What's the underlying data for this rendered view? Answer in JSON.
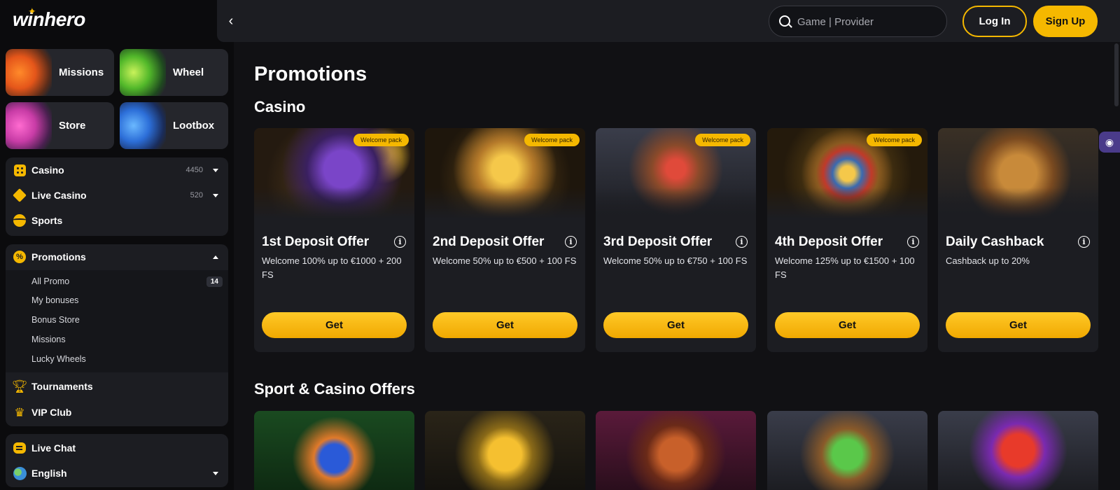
{
  "brand": {
    "logo_text": "winhero"
  },
  "sidebar": {
    "tiles": [
      {
        "label": "Missions"
      },
      {
        "label": "Wheel"
      },
      {
        "label": "Store"
      },
      {
        "label": "Lootbox"
      }
    ],
    "main_nav": [
      {
        "label": "Casino",
        "count": "4450",
        "icon": "dice-icon"
      },
      {
        "label": "Live Casino",
        "count": "520",
        "icon": "diamond-icon"
      },
      {
        "label": "Sports",
        "icon": "ball-icon"
      }
    ],
    "promotions": {
      "label": "Promotions",
      "icon": "promo-icon",
      "expanded": true,
      "items": [
        {
          "label": "All Promo",
          "badge": "14"
        },
        {
          "label": "My bonuses"
        },
        {
          "label": "Bonus Store"
        },
        {
          "label": "Missions"
        },
        {
          "label": "Lucky Wheels"
        }
      ]
    },
    "extra_nav": [
      {
        "label": "Tournaments",
        "icon": "trophy-icon"
      },
      {
        "label": "VIP Club",
        "icon": "crown-icon"
      }
    ],
    "footer_nav": [
      {
        "label": "Live Chat",
        "icon": "chat-icon"
      },
      {
        "label": "English",
        "icon": "globe-icon"
      }
    ]
  },
  "header": {
    "search_placeholder": "Game | Provider",
    "login_label": "Log In",
    "signup_label": "Sign Up"
  },
  "main": {
    "title": "Promotions",
    "sections": [
      {
        "title": "Casino",
        "cards": [
          {
            "tag": "Welcome pack",
            "title": "1st Deposit Offer",
            "description": "Welcome 100% up to €1000 + 200 FS",
            "button": "Get"
          },
          {
            "tag": "Welcome pack",
            "title": "2nd Deposit Offer",
            "description": "Welcome 50% up to €500 + 100 FS",
            "button": "Get"
          },
          {
            "tag": "Welcome pack",
            "title": "3rd Deposit Offer",
            "description": "Welcome 50% up to €750 + 100 FS",
            "button": "Get"
          },
          {
            "tag": "Welcome pack",
            "title": "4th Deposit Offer",
            "description": "Welcome 125% up to €1500 + 100 FS",
            "button": "Get"
          },
          {
            "title": "Daily Cashback",
            "description": "Cashback up to 20%",
            "button": "Get"
          }
        ]
      },
      {
        "title": "Sport & Casino Offers"
      }
    ]
  },
  "colors": {
    "accent": "#f5b800",
    "background": "#111114",
    "panel": "#1c1d22"
  }
}
